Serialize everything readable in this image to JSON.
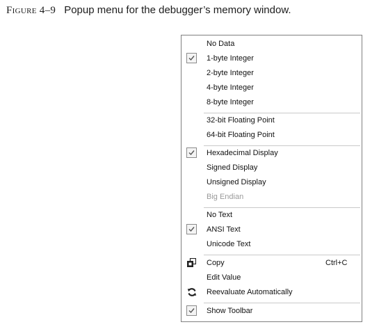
{
  "caption": {
    "label": "Figure 4–9",
    "text": "Popup menu for the debugger’s memory window."
  },
  "menu": {
    "items": [
      {
        "label": "No Data"
      },
      {
        "label": "1-byte Integer",
        "checked": true
      },
      {
        "label": "2-byte Integer"
      },
      {
        "label": "4-byte Integer"
      },
      {
        "label": "8-byte Integer"
      },
      {
        "label": "32-bit Floating Point"
      },
      {
        "label": "64-bit Floating Point"
      },
      {
        "label": "Hexadecimal Display",
        "checked": true
      },
      {
        "label": "Signed Display"
      },
      {
        "label": "Unsigned Display"
      },
      {
        "label": "Big Endian",
        "disabled": true
      },
      {
        "label": "No Text"
      },
      {
        "label": "ANSI Text",
        "checked": true
      },
      {
        "label": "Unicode Text"
      },
      {
        "label": "Copy",
        "icon": "copy-icon",
        "shortcut": "Ctrl+C"
      },
      {
        "label": "Edit Value"
      },
      {
        "label": "Reevaluate Automatically",
        "icon": "refresh-icon"
      },
      {
        "label": "Show Toolbar",
        "checked": true
      }
    ]
  }
}
